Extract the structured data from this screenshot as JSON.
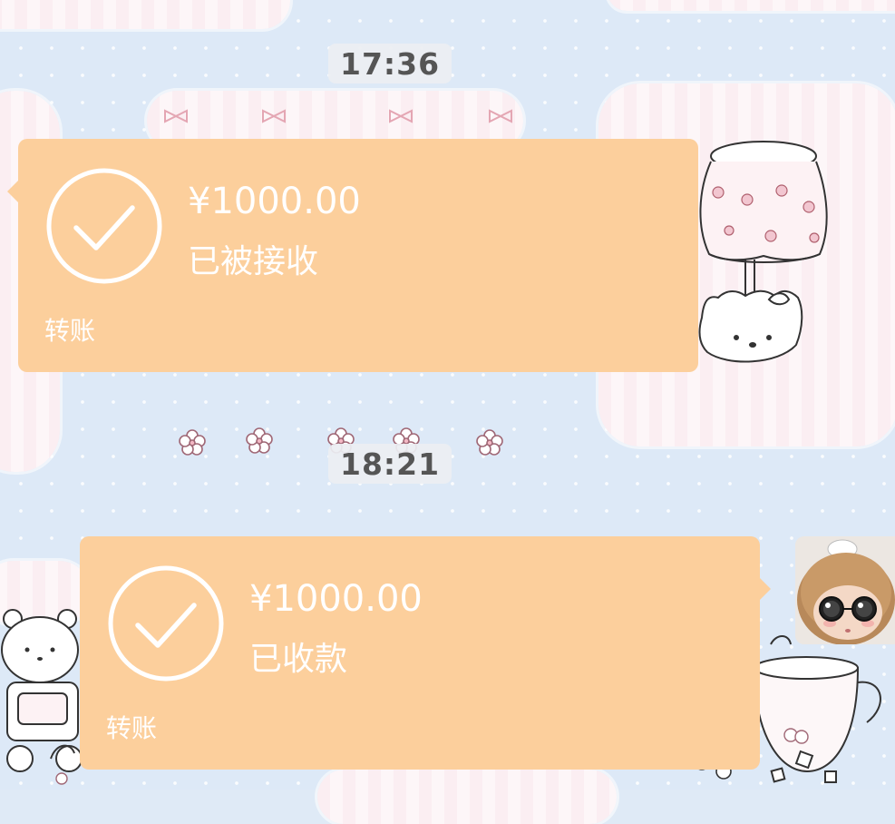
{
  "messages": [
    {
      "time": "17:36",
      "amount": "¥1000.00",
      "status": "已被接收",
      "label": "转账"
    },
    {
      "time": "18:21",
      "amount": "¥1000.00",
      "status": "已收款",
      "label": "转账"
    }
  ],
  "colors": {
    "bubble": "#fccf9c",
    "wallpaper": "#dde9f7",
    "timestamp_bg": "#eceef2",
    "text_on_bubble": "#ffffff"
  },
  "icons": {
    "check": "check-circle-icon",
    "avatar": "avatar"
  }
}
